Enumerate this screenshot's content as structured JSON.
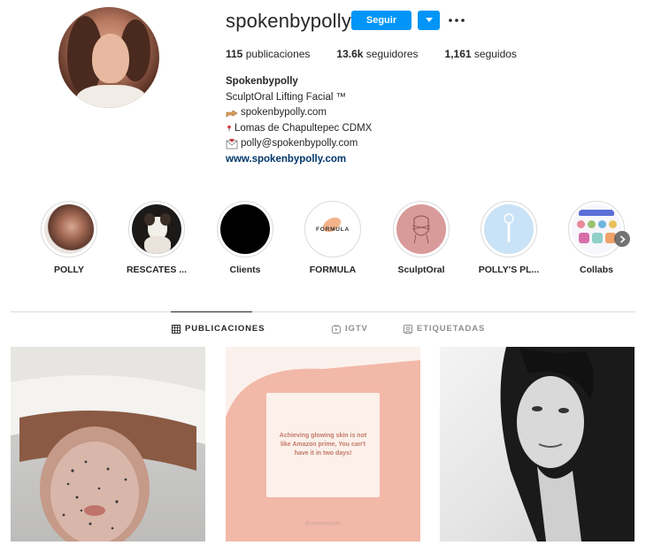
{
  "profile": {
    "username": "spokenbypolly",
    "follow_label": "Seguir",
    "stats": [
      {
        "value": "115",
        "label": "publicaciones"
      },
      {
        "value": "13.6k",
        "label": "seguidores"
      },
      {
        "value": "1,161",
        "label": "seguidos"
      }
    ],
    "bio": {
      "name": "Spokenbypolly",
      "tagline": "SculptOral Lifting Facial ™",
      "website_line": "spokenbypolly.com",
      "location_line": "Lomas de Chapultepec CDMX",
      "email_line": "polly@spokenbypolly.com",
      "link": "www.spokenbypolly.com"
    }
  },
  "highlights": [
    {
      "label": "POLLY",
      "icon": "portrait"
    },
    {
      "label": "RESCATES ...",
      "icon": "dog"
    },
    {
      "label": "Clients",
      "icon": "black-circle"
    },
    {
      "label": "FORMULA",
      "icon": "formula-logo",
      "inner_text": "FORMULA"
    },
    {
      "label": "SculptOral",
      "icon": "face-line-art"
    },
    {
      "label": "POLLY'S PL...",
      "icon": "roller-tool"
    },
    {
      "label": "Collabs",
      "icon": "collage"
    }
  ],
  "tabs": [
    {
      "label": "PUBLICACIONES",
      "icon": "grid-icon",
      "active": true
    },
    {
      "label": "IGTV",
      "icon": "igtv-icon",
      "active": false
    },
    {
      "label": "ETIQUETADAS",
      "icon": "tag-icon",
      "active": false
    }
  ],
  "posts": [
    {
      "type": "photo",
      "subject": "face-mask-treatment"
    },
    {
      "type": "quote",
      "text": "Achieving glowing skin is not like Amazon prime, You can't have it in two days!",
      "handle": "@spokenbypolly"
    },
    {
      "type": "photo",
      "subject": "bw-portrait"
    }
  ],
  "colors": {
    "accent": "#0095f6",
    "link": "#00376b",
    "quote_pink": "#f2b8a8",
    "quote_text": "#c47a69"
  }
}
